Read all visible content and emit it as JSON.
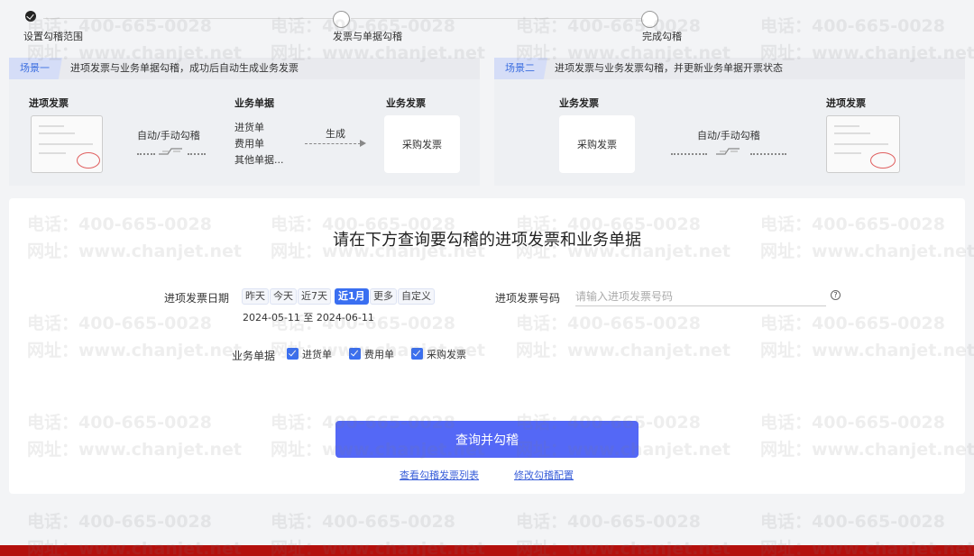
{
  "stepper": {
    "steps": [
      {
        "label": "设置勾稽范围",
        "status": "done"
      },
      {
        "label": "发票与单据勾稽",
        "status": "pending"
      },
      {
        "label": "完成勾稽",
        "status": "pending"
      }
    ]
  },
  "scenario_one": {
    "tag": "场景一",
    "description": "进项发票与业务单据勾稽，成功后自动生成业务发票",
    "col_input_invoice": "进项发票",
    "link_label": "自动/手动勾稽",
    "col_business_doc": "业务单据",
    "doc_types": [
      "进货单",
      "费用单",
      "其他单据..."
    ],
    "generate_label": "生成",
    "col_business_invoice": "业务发票",
    "purchase_invoice_card": "采购发票"
  },
  "scenario_two": {
    "tag": "场景二",
    "description": "进项发票与业务发票勾稽，并更新业务单据开票状态",
    "col_business_invoice": "业务发票",
    "purchase_invoice_card": "采购发票",
    "link_label": "自动/手动勾稽",
    "col_input_invoice": "进项发票"
  },
  "query": {
    "title": "请在下方查询要勾稽的进项发票和业务单据",
    "date_label": "进项发票日期",
    "date_chips": [
      {
        "label": "昨天",
        "active": false
      },
      {
        "label": "今天",
        "active": false
      },
      {
        "label": "近7天",
        "active": false
      },
      {
        "label": "近1月",
        "active": true
      },
      {
        "label": "更多",
        "active": false
      },
      {
        "label": "自定义",
        "active": false
      }
    ],
    "date_range": "2024-05-11 至 2024-06-11",
    "invoice_no_label": "进项发票号码",
    "invoice_no_placeholder": "请输入进项发票号码",
    "invoice_no_value": "",
    "help_icon": "question-circle-icon",
    "doc_label": "业务单据",
    "doc_options": [
      {
        "label": "进货单",
        "checked": true
      },
      {
        "label": "费用单",
        "checked": true
      },
      {
        "label": "采购发票",
        "checked": true
      }
    ],
    "submit_label": "查询并勾稽",
    "link_view_list": "查看勾稽发票列表",
    "link_edit_config": "修改勾稽配置"
  },
  "watermark": {
    "phone": "电话：400-665-0028",
    "site": "网址：www.chanjet.net"
  },
  "colors": {
    "accent": "#3a6ff1",
    "primary_button": "#5468f6",
    "bottom_bar": "#b4100d",
    "stamp": "#e06060"
  }
}
